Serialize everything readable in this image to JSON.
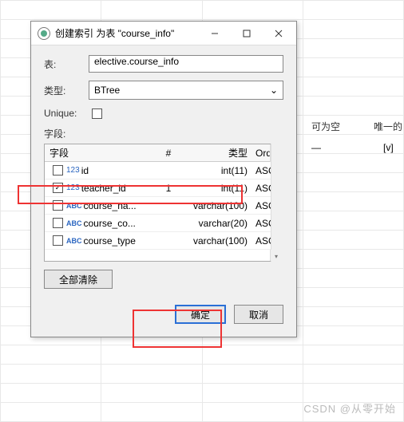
{
  "dialog": {
    "title": "创建索引 为表 \"course_info\"",
    "labels": {
      "table": "表:",
      "type": "类型:",
      "unique": "Unique:",
      "fields": "字段:"
    },
    "table_value": "elective.course_info",
    "type_value": "BTree",
    "columns": {
      "field": "字段",
      "num": "#",
      "type": "类型",
      "order": "Order"
    },
    "rows": [
      {
        "checked": false,
        "kind": "num",
        "name": "id",
        "num": "",
        "type": "int(11)",
        "order": "ASC"
      },
      {
        "checked": true,
        "kind": "num",
        "name": "teacher_id",
        "num": "1",
        "type": "int(11)",
        "order": "ASC"
      },
      {
        "checked": false,
        "kind": "abc",
        "name": "course_na...",
        "num": "",
        "type": "varchar(100)",
        "order": "ASC"
      },
      {
        "checked": false,
        "kind": "abc",
        "name": "course_co...",
        "num": "",
        "type": "varchar(20)",
        "order": "ASC"
      },
      {
        "checked": false,
        "kind": "abc",
        "name": "course_type",
        "num": "",
        "type": "varchar(100)",
        "order": "ASC"
      }
    ],
    "clear_all": "全部清除",
    "ok": "确定",
    "cancel": "取消"
  },
  "background": {
    "col_nullable": "可为空",
    "col_unique": "唯一的",
    "dash": "—",
    "v": "[v]"
  },
  "watermark": "CSDN @从零开始"
}
